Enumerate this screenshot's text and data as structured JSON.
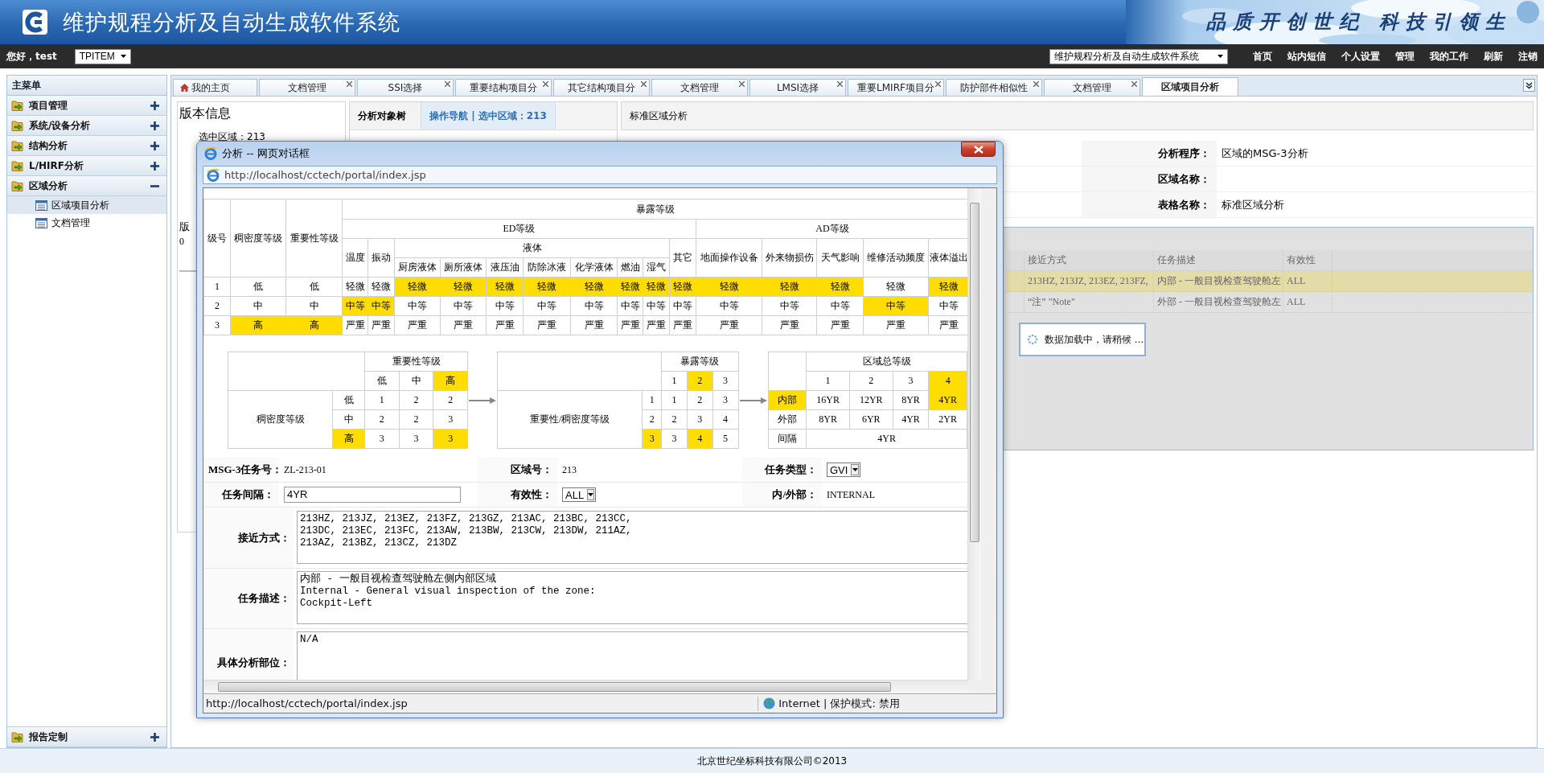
{
  "header": {
    "title": "维护规程分析及自动生成软件系统",
    "slogan": "品质开创世纪 科技引领生"
  },
  "nav": {
    "greeting": "您好，test",
    "project": "TPITEM",
    "system": "维护规程分析及自动生成软件系统",
    "links": [
      "首页",
      "站内短信",
      "个人设置",
      "管理",
      "我的工作",
      "刷新",
      "注销"
    ]
  },
  "sidebar": {
    "title": "主菜单",
    "items": [
      {
        "label": "项目管理",
        "expanded": false
      },
      {
        "label": "系统/设备分析",
        "expanded": false
      },
      {
        "label": "结构分析",
        "expanded": false
      },
      {
        "label": "L/HIRF分析",
        "expanded": false
      },
      {
        "label": "区域分析",
        "expanded": true,
        "children": [
          {
            "label": "区域项目分析",
            "selected": true
          },
          {
            "label": "文档管理",
            "selected": false
          }
        ]
      }
    ],
    "bottom_item": {
      "label": "报告定制",
      "expanded": false
    }
  },
  "tabs": [
    {
      "label": "我的主页",
      "kind": "home",
      "selected": false
    },
    {
      "label": "文档管理",
      "kind": "closable",
      "selected": false
    },
    {
      "label": "SSI选择",
      "kind": "closable",
      "selected": false
    },
    {
      "label": "重要结构项目分",
      "kind": "closable",
      "selected": false
    },
    {
      "label": "其它结构项目分",
      "kind": "closable",
      "selected": false
    },
    {
      "label": "文档管理",
      "kind": "closable",
      "selected": false
    },
    {
      "label": "LMSI选择",
      "kind": "closable",
      "selected": false
    },
    {
      "label": "重要LMIRF项目分",
      "kind": "closable",
      "selected": false
    },
    {
      "label": "防护部件相似性",
      "kind": "closable",
      "selected": false
    },
    {
      "label": "文档管理",
      "kind": "closable",
      "selected": false
    },
    {
      "label": "区域项目分析",
      "kind": "plain",
      "selected": true
    }
  ],
  "workspace": {
    "version_panel": {
      "title": "版本信息",
      "selected_area": "选中区域：213",
      "version_label": "版",
      "version_value": "0"
    },
    "tree_panel": {
      "title": "分析对象树",
      "nav_tab": "操作导航 | 选中区域：213"
    },
    "analysis_panel": {
      "title": "标准区域分析",
      "fields": [
        {
          "label": "分析程序：",
          "value": "区域的MSG-3分析"
        },
        {
          "label": "区域名称："
        },
        {
          "label": "表格名称：",
          "value": "标准区域分析"
        }
      ]
    },
    "grid": {
      "columns": [
        "接近方式",
        "任务描述",
        "有效性"
      ],
      "rows": [
        {
          "selected": true,
          "cells": [
            "213HZ, 213JZ, 213EZ, 213FZ,",
            "内部 - 一般目视检查驾驶舱左",
            "ALL"
          ]
        },
        {
          "selected": false,
          "cells": [
            "“注” \"Note\"",
            "外部 - 一般目视检查驾驶舱左",
            "ALL"
          ]
        }
      ],
      "loading": "数据加载中，请稍候 ..."
    }
  },
  "dialog": {
    "title": "分析 -- 网页对话框",
    "address": "http://localhost/cctech/portal/index.jsp",
    "exposure_table": {
      "title": "暴露等级",
      "ed_group": "ED等级",
      "ad_group": "AD等级",
      "liquid_group": "液体",
      "key_columns": [
        "级号",
        "稠密度等级",
        "重要性等级"
      ],
      "ed_before": [
        "温度",
        "振动"
      ],
      "liquid": [
        "厨房液体",
        "厕所液体",
        "液压油",
        "防除冰液",
        "化学液体",
        "燃油",
        "湿气"
      ],
      "ed_after": [
        "其它"
      ],
      "ad": [
        "地面操作设备",
        "外来物损伤",
        "天气影响",
        "维修活动频度",
        "液体溢出"
      ],
      "rows": [
        {
          "cells": [
            {
              "text": "1",
              "highlighted": false
            },
            {
              "text": "低",
              "highlighted": false
            },
            {
              "text": "低",
              "highlighted": false
            },
            {
              "text": "轻微",
              "highlighted": false
            },
            {
              "text": "轻微",
              "highlighted": false
            },
            {
              "text": "轻微",
              "highlighted": true
            },
            {
              "text": "轻微",
              "highlighted": true
            },
            {
              "text": "轻微",
              "highlighted": true
            },
            {
              "text": "轻微",
              "highlighted": true
            },
            {
              "text": "轻微",
              "highlighted": true
            },
            {
              "text": "轻微",
              "highlighted": true
            },
            {
              "text": "轻微",
              "highlighted": true
            },
            {
              "text": "轻微",
              "highlighted": true
            },
            {
              "text": "轻微",
              "highlighted": true
            },
            {
              "text": "轻微",
              "highlighted": true
            },
            {
              "text": "轻微",
              "highlighted": true
            },
            {
              "text": "轻微",
              "highlighted": false
            },
            {
              "text": "轻微",
              "highlighted": true
            }
          ]
        },
        {
          "cells": [
            {
              "text": "2",
              "highlighted": false
            },
            {
              "text": "中",
              "highlighted": false
            },
            {
              "text": "中",
              "highlighted": false
            },
            {
              "text": "中等",
              "highlighted": true
            },
            {
              "text": "中等",
              "highlighted": true
            },
            {
              "text": "中等",
              "highlighted": false
            },
            {
              "text": "中等",
              "highlighted": false
            },
            {
              "text": "中等",
              "highlighted": false
            },
            {
              "text": "中等",
              "highlighted": false
            },
            {
              "text": "中等",
              "highlighted": false
            },
            {
              "text": "中等",
              "highlighted": false
            },
            {
              "text": "中等",
              "highlighted": false
            },
            {
              "text": "中等",
              "highlighted": false
            },
            {
              "text": "中等",
              "highlighted": false
            },
            {
              "text": "中等",
              "highlighted": false
            },
            {
              "text": "中等",
              "highlighted": false
            },
            {
              "text": "中等",
              "highlighted": true
            },
            {
              "text": "中等",
              "highlighted": false
            }
          ]
        },
        {
          "cells": [
            {
              "text": "3",
              "highlighted": false
            },
            {
              "text": "高",
              "highlighted": true
            },
            {
              "text": "高",
              "highlighted": true
            },
            {
              "text": "严重",
              "highlighted": false
            },
            {
              "text": "严重",
              "highlighted": false
            },
            {
              "text": "严重",
              "highlighted": false
            },
            {
              "text": "严重",
              "highlighted": false
            },
            {
              "text": "严重",
              "highlighted": false
            },
            {
              "text": "严重",
              "highlighted": false
            },
            {
              "text": "严重",
              "highlighted": false
            },
            {
              "text": "严重",
              "highlighted": false
            },
            {
              "text": "严重",
              "highlighted": false
            },
            {
              "text": "严重",
              "highlighted": false
            },
            {
              "text": "严重",
              "highlighted": false
            },
            {
              "text": "严重",
              "highlighted": false
            },
            {
              "text": "严重",
              "highlighted": false
            },
            {
              "text": "严重",
              "highlighted": false
            },
            {
              "text": "严重",
              "highlighted": false
            }
          ]
        }
      ]
    },
    "importance_matrix": {
      "title": "重要性等级",
      "row_title": "稠密度等级",
      "columns": [
        {
          "text": "低",
          "highlighted": false
        },
        {
          "text": "中",
          "highlighted": false
        },
        {
          "text": "高",
          "highlighted": true
        }
      ],
      "rows": [
        {
          "label": {
            "text": "低",
            "highlighted": false
          },
          "cells": [
            {
              "text": "1",
              "highlighted": false
            },
            {
              "text": "2",
              "highlighted": false
            },
            {
              "text": "2",
              "highlighted": false
            }
          ]
        },
        {
          "label": {
            "text": "中",
            "highlighted": false
          },
          "cells": [
            {
              "text": "2",
              "highlighted": false
            },
            {
              "text": "2",
              "highlighted": false
            },
            {
              "text": "3",
              "highlighted": false
            }
          ]
        },
        {
          "label": {
            "text": "高",
            "highlighted": true
          },
          "cells": [
            {
              "text": "3",
              "highlighted": false
            },
            {
              "text": "3",
              "highlighted": false
            },
            {
              "text": "3",
              "highlighted": true
            }
          ]
        }
      ]
    },
    "exposure_matrix": {
      "title": "暴露等级",
      "row_title": "重要性/稠密度等级",
      "columns": [
        {
          "text": "1",
          "highlighted": false
        },
        {
          "text": "2",
          "highlighted": true
        },
        {
          "text": "3",
          "highlighted": false
        }
      ],
      "rows": [
        {
          "label": {
            "text": "1",
            "highlighted": false
          },
          "cells": [
            {
              "text": "1",
              "highlighted": false
            },
            {
              "text": "2",
              "highlighted": false
            },
            {
              "text": "3",
              "highlighted": false
            }
          ]
        },
        {
          "label": {
            "text": "2",
            "highlighted": false
          },
          "cells": [
            {
              "text": "2",
              "highlighted": false
            },
            {
              "text": "3",
              "highlighted": false
            },
            {
              "text": "4",
              "highlighted": false
            }
          ]
        },
        {
          "label": {
            "text": "3",
            "highlighted": true
          },
          "cells": [
            {
              "text": "3",
              "highlighted": false
            },
            {
              "text": "4",
              "highlighted": true
            },
            {
              "text": "5",
              "highlighted": false
            }
          ]
        }
      ]
    },
    "zone_matrix": {
      "title": "区域总等级",
      "columns": [
        {
          "text": "1",
          "highlighted": false
        },
        {
          "text": "2",
          "highlighted": false
        },
        {
          "text": "3",
          "highlighted": false
        },
        {
          "text": "4",
          "highlighted": true
        }
      ],
      "rows": [
        {
          "label": {
            "text": "内部",
            "highlighted": true
          },
          "cells": [
            {
              "text": "16YR",
              "highlighted": false
            },
            {
              "text": "12YR",
              "highlighted": false
            },
            {
              "text": "8YR",
              "highlighted": false
            },
            {
              "text": "4YR",
              "highlighted": true
            }
          ]
        },
        {
          "label": {
            "text": "外部",
            "highlighted": false
          },
          "cells": [
            {
              "text": "8YR",
              "highlighted": false
            },
            {
              "text": "6YR",
              "highlighted": false
            },
            {
              "text": "4YR",
              "highlighted": false
            },
            {
              "text": "2YR",
              "highlighted": false
            }
          ]
        }
      ],
      "interval": {
        "label": "间隔",
        "value": "4YR"
      }
    },
    "form_rows": [
      [
        {
          "kind": "text",
          "label": "MSG-3任务号：",
          "value": "ZL-213-01"
        },
        {
          "kind": "text",
          "label": "区域号：",
          "value": "213"
        },
        {
          "kind": "select",
          "label": "任务类型：",
          "value": "GVI"
        }
      ],
      [
        {
          "kind": "input",
          "label": "任务间隔：",
          "value": "4YR"
        },
        {
          "kind": "select",
          "label": "有效性：",
          "value": "ALL"
        },
        {
          "kind": "text",
          "label": "内/外部：",
          "value": "INTERNAL"
        }
      ]
    ],
    "text_areas": [
      {
        "label": "接近方式：",
        "value": "213HZ, 213JZ, 213EZ, 213FZ, 213GZ, 213AC, 213BC, 213CC,\n213DC, 213EC, 213FC, 213AW, 213BW, 213CW, 213DW, 211AZ,\n213AZ, 213BZ, 213CZ, 213DZ"
      },
      {
        "label": "任务描述：",
        "value": "内部 - 一般目视检查驾驶舱左侧内部区域\nInternal - General visual inspection of the zone:\nCockpit-Left"
      },
      {
        "label": "具体分析部位：",
        "value": "N/A"
      }
    ],
    "status": {
      "url": "http://localhost/cctech/portal/index.jsp",
      "zone": "Internet | 保护模式: 禁用"
    }
  },
  "footer": "北京世纪坐标科技有限公司©2013"
}
